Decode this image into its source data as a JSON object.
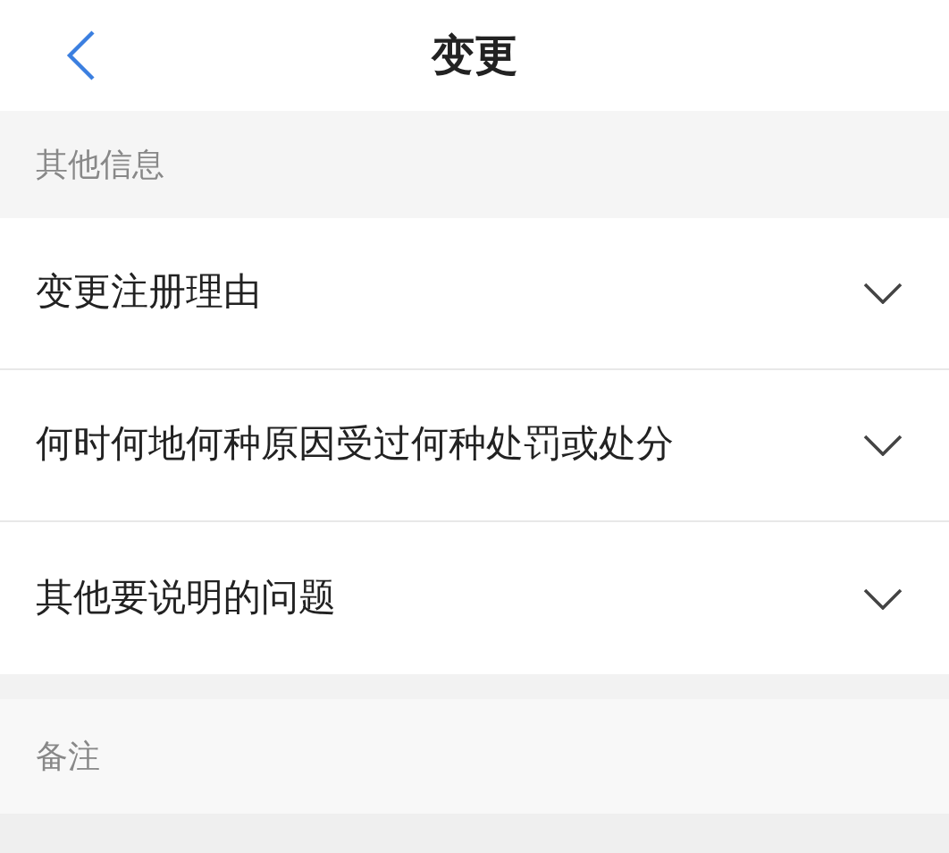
{
  "header": {
    "title": "变更"
  },
  "sections": [
    {
      "title": "其他信息",
      "rows": [
        {
          "label": "变更注册理由",
          "expanded": false
        },
        {
          "label": "何时何地何种原因受过何种处罚或处分",
          "expanded": false
        },
        {
          "label": "其他要说明的问题",
          "expanded": false
        }
      ]
    },
    {
      "title": "备注"
    }
  ]
}
